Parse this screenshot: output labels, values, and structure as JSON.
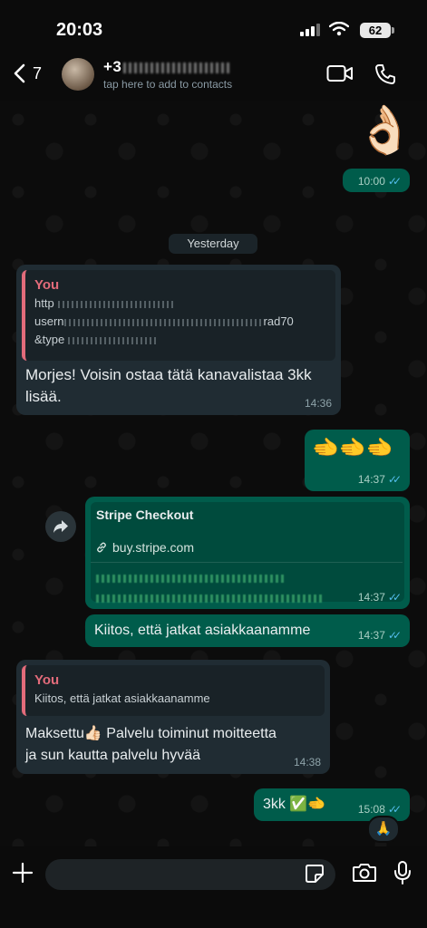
{
  "status": {
    "time": "20:03",
    "battery": "62"
  },
  "header": {
    "back_count": "7",
    "contact_name": "+3",
    "subtitle": "tap here to add to contacts"
  },
  "chat": {
    "top_emoji": "👌🏻",
    "top_time": "10:00",
    "day_label": "Yesterday",
    "msg1": {
      "quote_name": "You",
      "quote_line1": "http",
      "quote_line2": "usern",
      "quote_line2_end": "rad70",
      "quote_line3": "&type",
      "text": "Morjes! Voisin ostaa tätä kanavalistaa 3kk lisää.",
      "time": "14:36"
    },
    "msg2": {
      "text": "🫲🫲🫲",
      "time": "14:37"
    },
    "msg3": {
      "title": "Stripe Checkout",
      "domain": "buy.stripe.com",
      "time": "14:37"
    },
    "msg4": {
      "text": "Kiitos, että jatkat asiakkaanamme",
      "time": "14:37"
    },
    "msg5": {
      "quote_name": "You",
      "quote_text": "Kiitos, että jatkat asiakkaanamme",
      "text": "Maksettu👍🏻 Palvelu toiminut moitteetta ja sun kautta palvelu hyvää",
      "time": "14:38"
    },
    "msg6": {
      "text": "3kk ✅🫲",
      "time": "15:08",
      "reaction": "🙏"
    }
  },
  "composer": {
    "placeholder": ""
  }
}
